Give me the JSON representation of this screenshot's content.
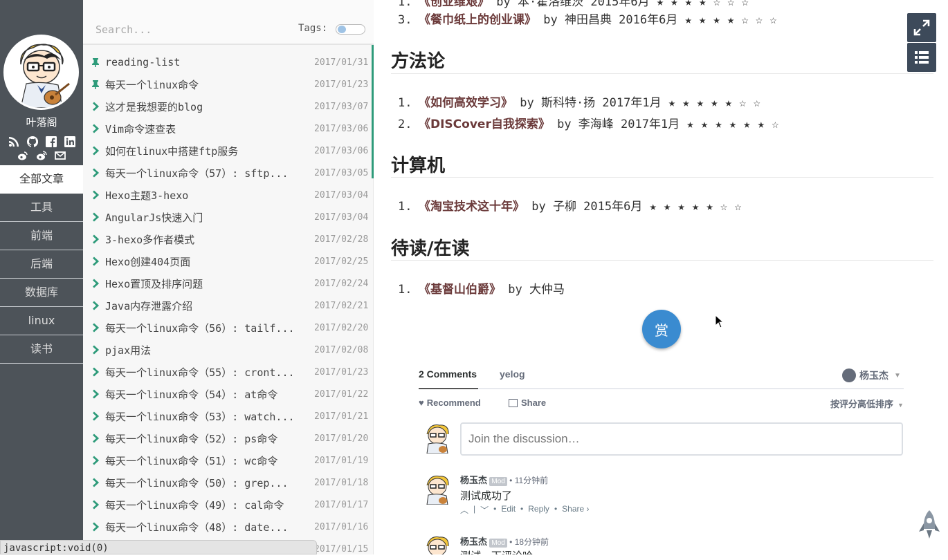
{
  "sidebar": {
    "site_name": "叶落阁",
    "social_icons": [
      "rss-icon",
      "github-icon",
      "facebook-icon",
      "linkedin-icon",
      "weibo-icon",
      "weibo-icon",
      "mail-icon"
    ],
    "nav": [
      {
        "label": "全部文章",
        "active": true
      },
      {
        "label": "工具"
      },
      {
        "label": "前端"
      },
      {
        "label": "后端"
      },
      {
        "label": "数据库"
      },
      {
        "label": "linux"
      },
      {
        "label": "读书"
      }
    ]
  },
  "search": {
    "placeholder": "Search...",
    "tags_label": "Tags:"
  },
  "posts": [
    {
      "title": "reading-list",
      "date": "2017/01/31",
      "pinned": true
    },
    {
      "title": "每天一个linux命令",
      "date": "2017/01/23",
      "pinned": true
    },
    {
      "title": "这才是我想要的blog",
      "date": "2017/03/07"
    },
    {
      "title": "Vim命令速查表",
      "date": "2017/03/06"
    },
    {
      "title": "如何在linux中搭建ftp服务",
      "date": "2017/03/06"
    },
    {
      "title": "每天一个linux命令（57）: sftp...",
      "date": "2017/03/05"
    },
    {
      "title": "Hexo主题3-hexo",
      "date": "2017/03/04"
    },
    {
      "title": "AngularJs快速入门",
      "date": "2017/03/04"
    },
    {
      "title": "3-hexo多作者模式",
      "date": "2017/02/28"
    },
    {
      "title": "Hexo创建404页面",
      "date": "2017/02/25"
    },
    {
      "title": "Hexo置顶及排序问题",
      "date": "2017/02/24"
    },
    {
      "title": "Java内存泄露介绍",
      "date": "2017/02/21"
    },
    {
      "title": "每天一个linux命令（56）: tailf...",
      "date": "2017/02/20"
    },
    {
      "title": "pjax用法",
      "date": "2017/02/08"
    },
    {
      "title": "每天一个linux命令（55）: cront...",
      "date": "2017/01/23"
    },
    {
      "title": "每天一个linux命令（54）: at命令",
      "date": "2017/01/22"
    },
    {
      "title": "每天一个linux命令（53）: watch...",
      "date": "2017/01/21"
    },
    {
      "title": "每天一个linux命令（52）: ps命令",
      "date": "2017/01/20"
    },
    {
      "title": "每天一个linux命令（51）: wc命令",
      "date": "2017/01/19"
    },
    {
      "title": "每天一个linux命令（50）: grep...",
      "date": "2017/01/18"
    },
    {
      "title": "每天一个linux命令（49）: cal命令",
      "date": "2017/01/17"
    },
    {
      "title": "每天一个linux命令（48）: date...",
      "date": "2017/01/16"
    },
    {
      "title": "",
      "date": "2017/01/15"
    }
  ],
  "status_bar": "javascript:void(0)",
  "article": {
    "top_item": {
      "num": "3.",
      "book": "《餐巾纸上的创业课》",
      "rest": " by 神田昌典 2016年6月 ★ ★ ★ ★ ☆ ☆ ☆"
    },
    "sections": [
      {
        "heading": "方法论",
        "items": [
          {
            "num": "1.",
            "book": "《如何高效学习》",
            "rest": " by 斯科特·扬 2017年1月 ★ ★ ★ ★ ★ ☆ ☆"
          },
          {
            "num": "2.",
            "book": "《DISCover自我探索》",
            "rest": " by 李海峰 2017年1月 ★ ★ ★ ★ ★ ★ ☆"
          }
        ]
      },
      {
        "heading": "计算机",
        "items": [
          {
            "num": "1.",
            "book": "《淘宝技术这十年》",
            "rest": " by 子柳 2015年6月 ★ ★ ★ ★ ★ ☆ ☆"
          }
        ]
      },
      {
        "heading": "待读/在读",
        "items": [
          {
            "num": "1.",
            "book": "《基督山伯爵》",
            "rest": " by 大仲马"
          }
        ]
      }
    ],
    "reward_label": "赏"
  },
  "comments": {
    "tab_count": "2 Comments",
    "tab_site": "yelog",
    "user": "杨玉杰",
    "recommend": "Recommend",
    "share": "Share",
    "sort": "按评分高低排序",
    "placeholder": "Join the discussion…",
    "list": [
      {
        "author": "杨玉杰",
        "badge": "Mod",
        "time": "11分钟前",
        "text": "测试成功了",
        "actions": [
          "Edit",
          "Reply",
          "Share ›"
        ]
      },
      {
        "author": "杨玉杰",
        "badge": "Mod",
        "time": "18分钟前",
        "text": "测试一下评论哈"
      }
    ]
  },
  "colors": {
    "sidebar": "#4d5359",
    "accent_green": "#2e9b7a",
    "book_title": "#6b3a3a",
    "reward": "#3a8bd0",
    "tool_btn": "#3d4a5a"
  }
}
